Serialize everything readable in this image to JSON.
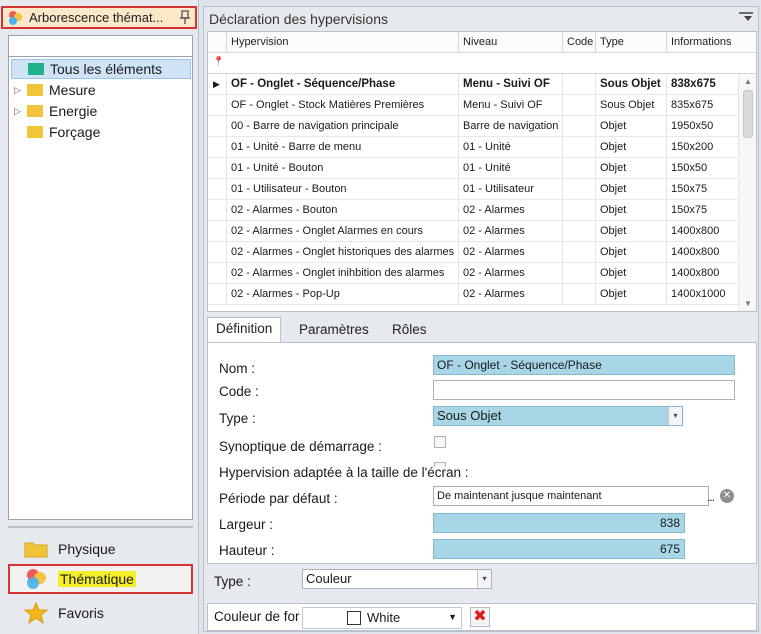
{
  "left_panel": {
    "header_title": "Arborescence thémat...",
    "tree": [
      {
        "label": "Tous les éléments",
        "selected": true,
        "has_expander": false,
        "color": "#1fb38a"
      },
      {
        "label": "Mesure",
        "selected": false,
        "has_expander": true,
        "color": "#f2c43a"
      },
      {
        "label": "Energie",
        "selected": false,
        "has_expander": true,
        "color": "#f2c43a"
      },
      {
        "label": "Forçage",
        "selected": false,
        "has_expander": false,
        "color": "#f2c43a"
      }
    ],
    "nav": [
      {
        "label": "Physique",
        "icon": "folder-icon"
      },
      {
        "label": "Thématique",
        "icon": "thematic-icon",
        "highlighted": true
      },
      {
        "label": "Favoris",
        "icon": "star-icon"
      }
    ]
  },
  "right_panel": {
    "title": "Déclaration des hypervisions",
    "grid": {
      "columns": [
        "Hypervision",
        "Niveau",
        "Code",
        "Type",
        "Informations"
      ],
      "rows": [
        {
          "hypervision": "OF - Onglet - Séquence/Phase",
          "niveau": "Menu - Suivi OF",
          "code": "",
          "type": "Sous Objet",
          "info": "838x675",
          "current": true
        },
        {
          "hypervision": "OF - Onglet - Stock Matières Premières",
          "niveau": "Menu - Suivi OF",
          "code": "",
          "type": "Sous Objet",
          "info": "835x675"
        },
        {
          "hypervision": "00 - Barre de navigation principale",
          "niveau": "Barre de navigation",
          "code": "",
          "type": "Objet",
          "info": "1950x50"
        },
        {
          "hypervision": "01 - Unité - Barre de menu",
          "niveau": "01 - Unité",
          "code": "",
          "type": "Objet",
          "info": "150x200"
        },
        {
          "hypervision": "01 - Unité - Bouton",
          "niveau": "01 - Unité",
          "code": "",
          "type": "Objet",
          "info": "150x50"
        },
        {
          "hypervision": "01 - Utilisateur - Bouton",
          "niveau": "01 - Utilisateur",
          "code": "",
          "type": "Objet",
          "info": "150x75"
        },
        {
          "hypervision": "02 - Alarmes - Bouton",
          "niveau": "02 - Alarmes",
          "code": "",
          "type": "Objet",
          "info": "150x75"
        },
        {
          "hypervision": "02 - Alarmes - Onglet Alarmes en cours",
          "niveau": "02 - Alarmes",
          "code": "",
          "type": "Objet",
          "info": "1400x800"
        },
        {
          "hypervision": "02 - Alarmes - Onglet historiques des alarmes",
          "niveau": "02 - Alarmes",
          "code": "",
          "type": "Objet",
          "info": "1400x800"
        },
        {
          "hypervision": "02 - Alarmes - Onglet inihbition des alarmes",
          "niveau": "02 - Alarmes",
          "code": "",
          "type": "Objet",
          "info": "1400x800"
        },
        {
          "hypervision": "02 - Alarmes - Pop-Up",
          "niveau": "02 - Alarmes",
          "code": "",
          "type": "Objet",
          "info": "1400x1000"
        }
      ]
    },
    "tabs": [
      "Définition",
      "Paramètres",
      "Rôles"
    ],
    "form": {
      "nom_label": "Nom :",
      "nom_value": "OF - Onglet - Séquence/Phase",
      "code_label": "Code :",
      "code_value": "",
      "type_label": "Type :",
      "type_value": "Sous Objet",
      "synoptique_label": "Synoptique de démarrage :",
      "adaptee_label": "Hypervision adaptée à la taille de l'écran :",
      "periode_label": "Période par défaut :",
      "periode_value": "De maintenant jusque maintenant",
      "largeur_label": "Largeur :",
      "largeur_value": "838",
      "hauteur_label": "Hauteur :",
      "hauteur_value": "675"
    },
    "type_row": {
      "label": "Type :",
      "value": "Couleur"
    },
    "color_row": {
      "label": "Couleur de for",
      "value": "White",
      "swatch": "#ffffff"
    }
  },
  "colors": {
    "highlight_border": "#d83232",
    "selection_blue": "#a8d6e6",
    "highlight_yellow": "#f4ef2a"
  }
}
